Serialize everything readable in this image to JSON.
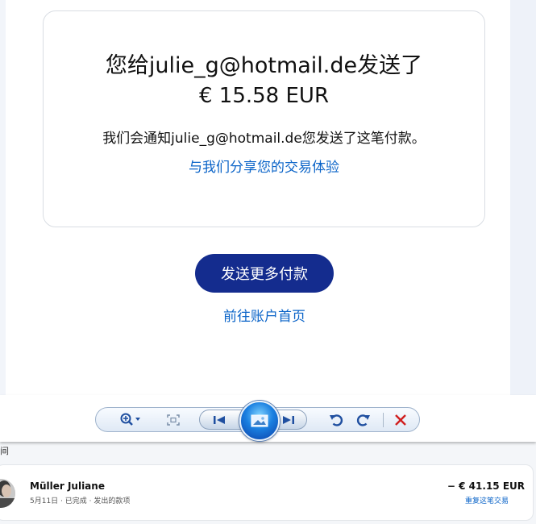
{
  "payment": {
    "title": "您给julie_g@hotmail.de发送了",
    "amount": "€ 15.58 EUR",
    "notify_text": "我们会通知julie_g@hotmail.de您发送了这笔付款。",
    "feedback_link": "与我们分享您的交易体验",
    "send_more_button": "发送更多付款",
    "home_link": "前往账户首页"
  },
  "viewer_toolbar": {
    "icons": [
      "zoom-icon",
      "fit-window-icon",
      "previous-icon",
      "slideshow-icon",
      "next-icon",
      "rotate-left-icon",
      "rotate-right-icon",
      "delete-icon"
    ],
    "accent": "#1a7fe0",
    "delete_color": "#d01e1e"
  },
  "transactions": {
    "edge_char": "间",
    "items": [
      {
        "name": "Müller Juliane",
        "meta": "5月11日 · 已完成 · 发出的款项",
        "amount": "− € 41.15 EUR",
        "repeat_link": "重复这笔交易"
      }
    ]
  },
  "colors": {
    "primary_button": "#142c8e",
    "link": "#0b64c8"
  }
}
